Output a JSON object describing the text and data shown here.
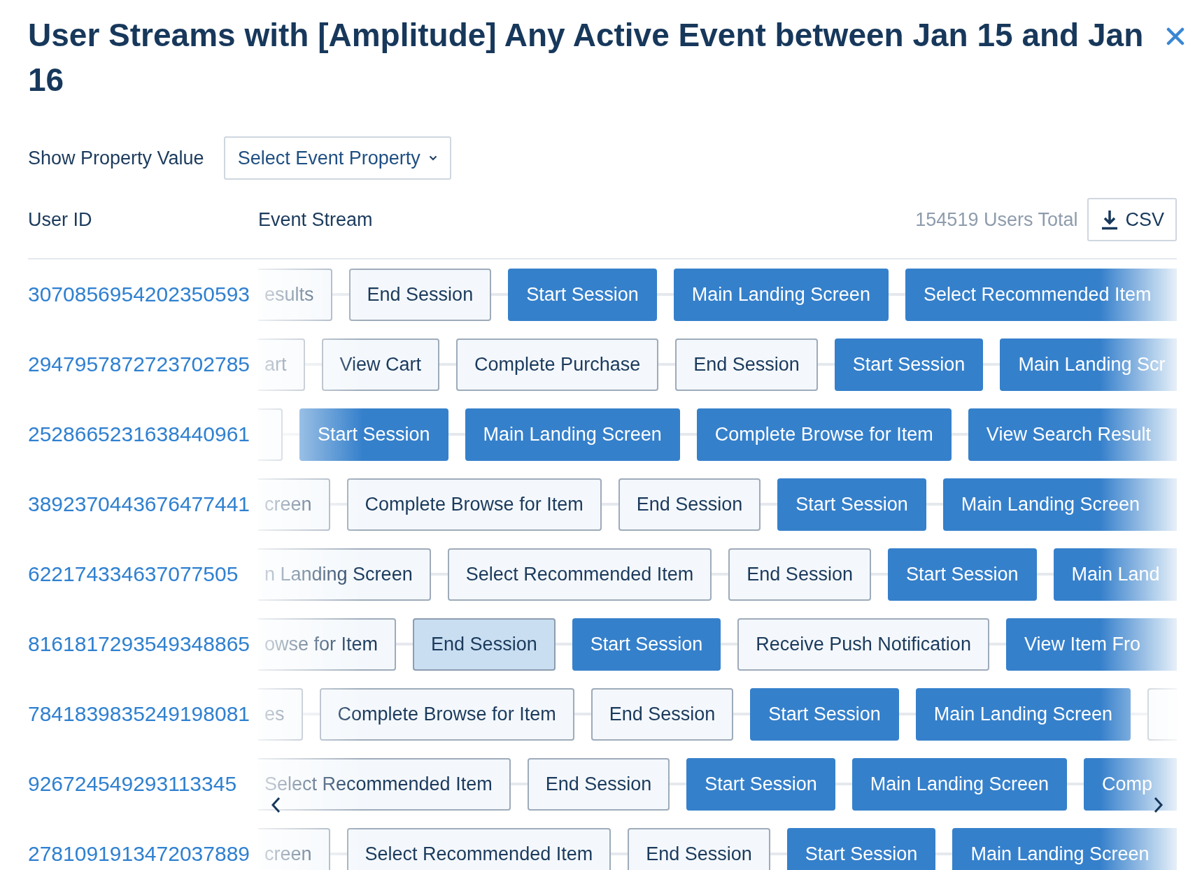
{
  "dialog": {
    "title": "User Streams with [Amplitude] Any Active Event between Jan 15 and Jan 16"
  },
  "property_filter": {
    "label": "Show Property Value",
    "dropdown": {
      "label": "Select Event Property"
    }
  },
  "table": {
    "columns": [
      "User ID",
      "Event Stream"
    ],
    "total": "154519 Users Total",
    "export_button": {
      "label": "CSV"
    },
    "rows": [
      {
        "user_id": "3070856954202350593",
        "events": [
          {
            "label": "esults",
            "kind": "outline"
          },
          {
            "label": "End Session",
            "kind": "outline"
          },
          {
            "label": "Start Session",
            "kind": "filled"
          },
          {
            "label": "Main Landing Screen",
            "kind": "filled"
          },
          {
            "label": "Select Recommended Item",
            "kind": "filled"
          }
        ]
      },
      {
        "user_id": "2947957872723702785",
        "events": [
          {
            "label": "art",
            "kind": "outline"
          },
          {
            "label": "View Cart",
            "kind": "outline"
          },
          {
            "label": "Complete Purchase",
            "kind": "outline"
          },
          {
            "label": "End Session",
            "kind": "outline"
          },
          {
            "label": "Start Session",
            "kind": "filled"
          },
          {
            "label": "Main Landing Scr",
            "kind": "filled"
          }
        ]
      },
      {
        "user_id": "2528665231638440961",
        "events": [
          {
            "kind": "outline"
          },
          {
            "label": "Start Session",
            "kind": "filled"
          },
          {
            "label": "Main Landing Screen",
            "kind": "filled"
          },
          {
            "label": "Complete Browse for Item",
            "kind": "filled"
          },
          {
            "label": "View Search Result",
            "kind": "filled"
          }
        ]
      },
      {
        "user_id": "3892370443676477441",
        "events": [
          {
            "label": "creen",
            "kind": "outline"
          },
          {
            "label": "Complete Browse for Item",
            "kind": "outline"
          },
          {
            "label": "End Session",
            "kind": "outline"
          },
          {
            "label": "Start Session",
            "kind": "filled"
          },
          {
            "label": "Main Landing Screen",
            "kind": "filled"
          }
        ]
      },
      {
        "user_id": "622174334637077505",
        "events": [
          {
            "label": "n Landing Screen",
            "kind": "outline"
          },
          {
            "label": "Select Recommended Item",
            "kind": "outline"
          },
          {
            "label": "End Session",
            "kind": "outline"
          },
          {
            "label": "Start Session",
            "kind": "filled"
          },
          {
            "label": "Main Land",
            "kind": "filled"
          }
        ]
      },
      {
        "user_id": "8161817293549348865",
        "events": [
          {
            "label": "owse for Item",
            "kind": "outline"
          },
          {
            "label": "End Session",
            "kind": "highlighted"
          },
          {
            "label": "Start Session",
            "kind": "filled"
          },
          {
            "label": "Receive Push Notification",
            "kind": "outline"
          },
          {
            "label": "View Item Fro",
            "kind": "filled"
          }
        ]
      },
      {
        "user_id": "7841839835249198081",
        "events": [
          {
            "label": "es",
            "kind": "outline"
          },
          {
            "label": "Complete Browse for Item",
            "kind": "outline"
          },
          {
            "label": "End Session",
            "kind": "outline"
          },
          {
            "label": "Start Session",
            "kind": "filled"
          },
          {
            "label": "Main Landing Screen",
            "kind": "filled"
          },
          {
            "kind": "outline"
          }
        ]
      },
      {
        "user_id": "926724549293113345",
        "events": [
          {
            "label": "Select Recommended Item",
            "kind": "outline"
          },
          {
            "label": "End Session",
            "kind": "outline"
          },
          {
            "label": "Start Session",
            "kind": "filled"
          },
          {
            "label": "Main Landing Screen",
            "kind": "filled"
          },
          {
            "label": "Comp",
            "kind": "filled"
          }
        ]
      },
      {
        "user_id": "2781091913472037889",
        "events": [
          {
            "label": "creen",
            "kind": "outline"
          },
          {
            "label": "Select Recommended Item",
            "kind": "outline"
          },
          {
            "label": "End Session",
            "kind": "outline"
          },
          {
            "label": "Start Session",
            "kind": "filled"
          },
          {
            "label": "Main Landing Screen",
            "kind": "filled"
          }
        ]
      }
    ]
  }
}
